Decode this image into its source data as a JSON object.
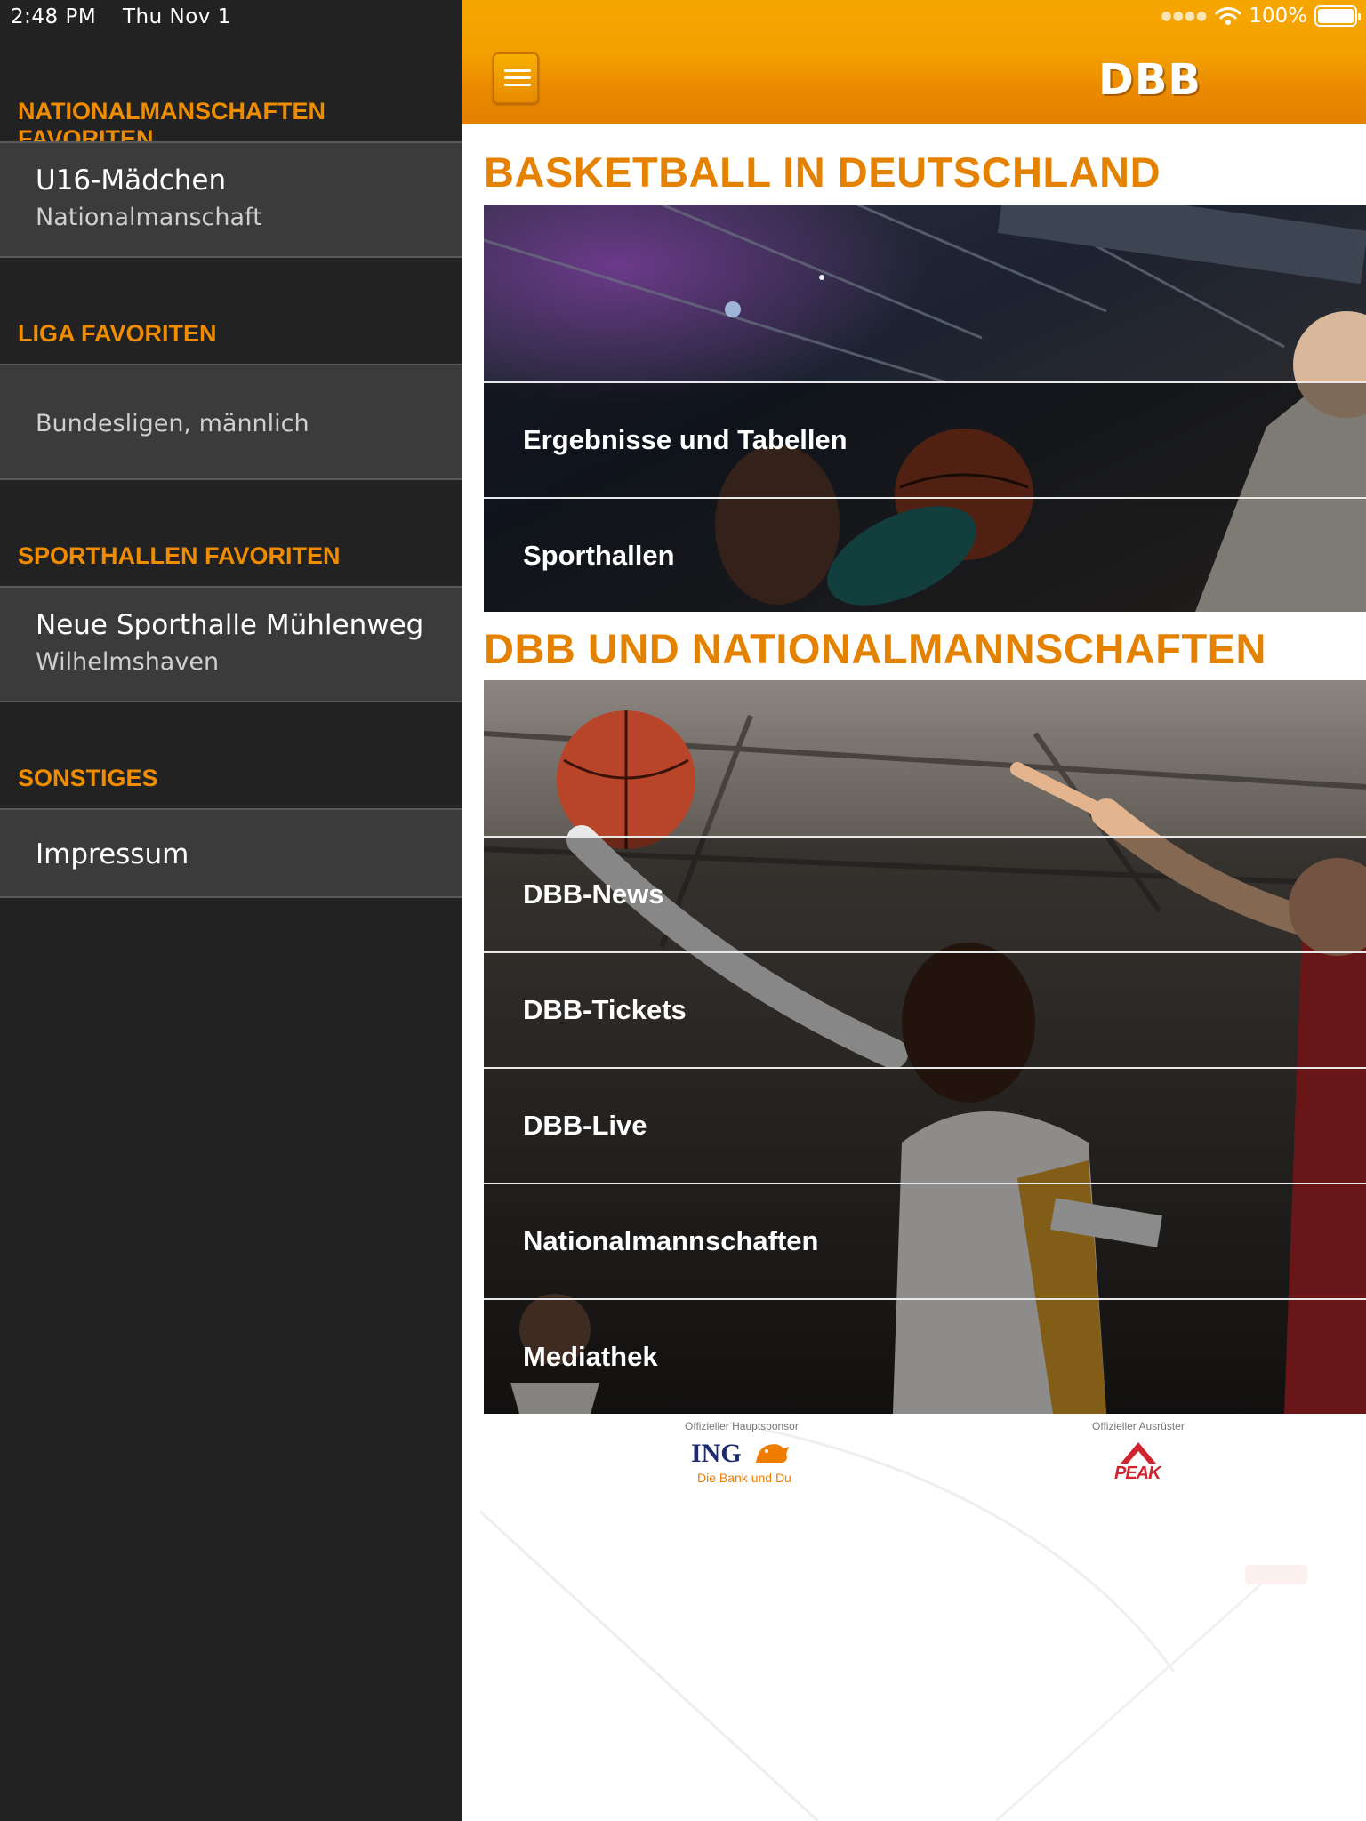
{
  "status": {
    "time": "2:48 PM",
    "date": "Thu Nov 1",
    "battery": "100%",
    "wifi_icon": "wifi-icon",
    "battery_icon": "battery-icon",
    "signal_icon": "signal-dots-icon"
  },
  "colors": {
    "accent": "#E48200",
    "sidebar_bg": "#222222",
    "sidebar_item_bg": "#3B3B3B",
    "header_orange": "#F3A000"
  },
  "sidebar": {
    "sections": [
      {
        "header": "NATIONALMANSCHAFTEN FAVORITEN",
        "items": [
          {
            "title": "U16-Mädchen",
            "subtitle": "Nationalmanschaft"
          }
        ]
      },
      {
        "header": "LIGA FAVORITEN",
        "items": [
          {
            "title": "",
            "subtitle": "Bundesligen, männlich"
          }
        ]
      },
      {
        "header": "SPORTHALLEN FAVORITEN",
        "items": [
          {
            "title": "Neue Sporthalle Mühlenweg",
            "subtitle": "Wilhelmshaven"
          }
        ]
      },
      {
        "header": "SONSTIGES",
        "items": [
          {
            "title": "Impressum",
            "subtitle": ""
          }
        ]
      }
    ]
  },
  "header": {
    "menu_icon": "hamburger-menu-icon",
    "logo": "DBB"
  },
  "main": {
    "sections": [
      {
        "title": "BASKETBALL IN DEUTSCHLAND",
        "items": [
          "Ergebnisse und Tabellen",
          "Sporthallen"
        ]
      },
      {
        "title": "DBB UND NATIONALMANNSCHAFTEN",
        "items": [
          "DBB-News",
          "DBB-Tickets",
          "DBB-Live",
          "Nationalmannschaften",
          "Mediathek"
        ]
      }
    ]
  },
  "sponsors": [
    {
      "caption": "Offizieller Hauptsponsor",
      "name": "ING",
      "tagline": "Die Bank und Du"
    },
    {
      "caption": "Offizieller Ausrüster",
      "name": "PEAK"
    }
  ]
}
